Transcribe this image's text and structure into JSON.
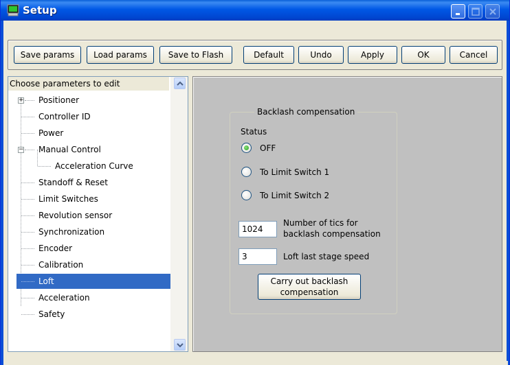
{
  "window": {
    "title": "Setup",
    "icon": "app-icon",
    "controls": {
      "minimize": "minimize-icon",
      "maximize": "maximize-icon",
      "close": "close-icon"
    }
  },
  "toolbar": {
    "buttons": [
      {
        "label": "Save params"
      },
      {
        "label": "Load params"
      },
      {
        "label": "Save to Flash"
      },
      {
        "label": "Default"
      },
      {
        "label": "Undo"
      },
      {
        "label": "Apply"
      },
      {
        "label": "OK"
      },
      {
        "label": "Cancel"
      }
    ]
  },
  "tree": {
    "header": "Choose parameters to edit",
    "items": [
      {
        "label": "Positioner",
        "expander": "+"
      },
      {
        "label": "Controller ID"
      },
      {
        "label": "Power"
      },
      {
        "label": "Manual Control",
        "expander": "−"
      },
      {
        "label": "Acceleration Curve"
      },
      {
        "label": "Standoff & Reset"
      },
      {
        "label": "Limit Switches"
      },
      {
        "label": "Revolution sensor"
      },
      {
        "label": "Synchronization"
      },
      {
        "label": "Encoder"
      },
      {
        "label": "Calibration"
      },
      {
        "label": "Loft",
        "selected": true
      },
      {
        "label": "Acceleration"
      },
      {
        "label": "Safety"
      }
    ]
  },
  "panel": {
    "group_title": "Backlash  compensation",
    "status_label": "Status",
    "options": [
      {
        "label": "OFF",
        "selected": true
      },
      {
        "label": "To Limit Switch 1",
        "selected": false
      },
      {
        "label": "To Limit Switch 2",
        "selected": false
      }
    ],
    "tics": {
      "value": "1024",
      "label_line1": "Number of tics for",
      "label_line2": "backlash compensation"
    },
    "loft_speed": {
      "value": "3",
      "label": "Loft last stage speed"
    },
    "carry_out": {
      "line1": "Carry out backlash",
      "line2": "compensation"
    }
  },
  "colors": {
    "title_bar": "#0054e3",
    "selection": "#316ac5",
    "panel_background": "#c0c0c0",
    "dialog_background": "#ece9d8"
  }
}
